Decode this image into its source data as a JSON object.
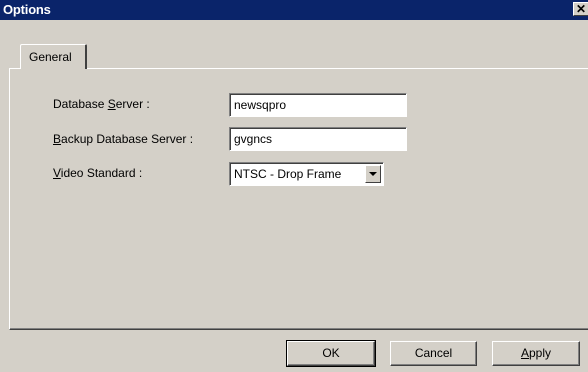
{
  "window": {
    "title": "Options",
    "close_glyph": "✕"
  },
  "tabs": [
    {
      "label": "General"
    }
  ],
  "form": {
    "database_server": {
      "label_prefix": "Database ",
      "label_accel": "S",
      "label_suffix": "erver :",
      "value": "newsqpro"
    },
    "backup_server": {
      "label_prefix": "",
      "label_accel": "B",
      "label_suffix": "ackup Database Server :",
      "value": "gvgncs"
    },
    "video_standard": {
      "label_prefix": "",
      "label_accel": "V",
      "label_suffix": "ideo Standard :",
      "value": "NTSC - Drop Frame"
    }
  },
  "buttons": {
    "ok": {
      "label": "OK"
    },
    "cancel": {
      "label": "Cancel"
    },
    "apply": {
      "label_accel": "A",
      "label_suffix": "pply"
    }
  },
  "icons": {
    "close": "close-icon",
    "dropdown": "chevron-down-icon"
  }
}
